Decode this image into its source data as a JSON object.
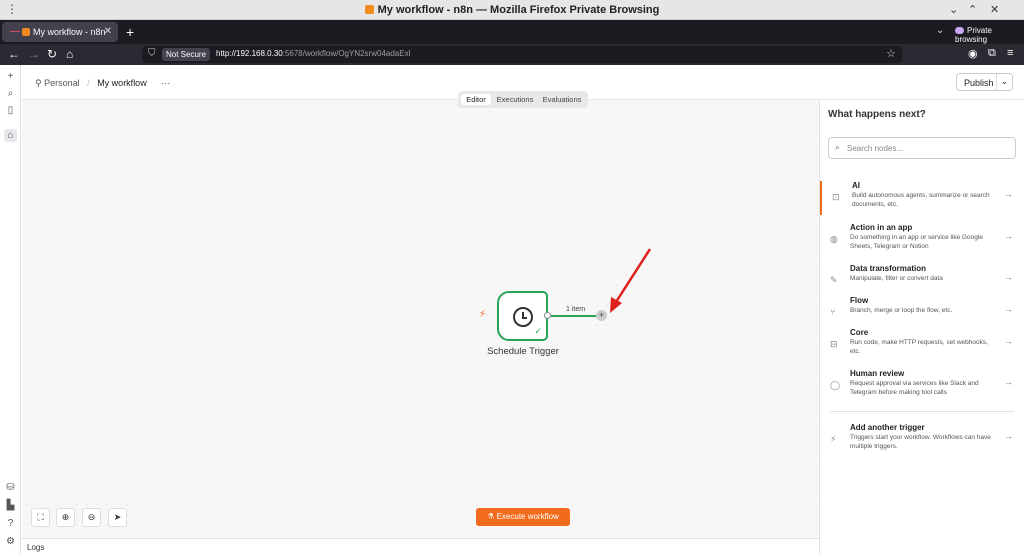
{
  "browser": {
    "window_title": "My workflow - n8n — Mozilla Firefox Private Browsing",
    "tab_title": "My workflow - n8n",
    "private_label": "Private browsing",
    "not_secure_label": "Not Secure",
    "url_host": "http://192.168.0.30",
    "url_rest": ":5678/workflow/OgYN2srw04adaExl"
  },
  "header": {
    "breadcrumb_personal": "Personal",
    "breadcrumb_separator": "/",
    "workflow_name": "My workflow",
    "more_label": "···",
    "publish_label": "Publish"
  },
  "view_tabs": [
    "Editor",
    "Executions",
    "Evaluations"
  ],
  "canvas": {
    "node_name": "Schedule Trigger",
    "connection_label": "1 item",
    "execute_label": "Execute workflow"
  },
  "footer": {
    "logs_label": "Logs"
  },
  "panel": {
    "title": "What happens next?",
    "search_placeholder": "Search nodes...",
    "options": [
      {
        "title": "AI",
        "desc": "Build autonomous agents, summarize or search documents, etc.",
        "icon": "robot-icon"
      },
      {
        "title": "Action in an app",
        "desc": "Do something in an app or service like Google Sheets, Telegram or Notion",
        "icon": "globe-icon"
      },
      {
        "title": "Data transformation",
        "desc": "Manipulate, filter or convert data",
        "icon": "pen-icon"
      },
      {
        "title": "Flow",
        "desc": "Branch, merge or loop the flow, etc.",
        "icon": "branch-icon"
      },
      {
        "title": "Core",
        "desc": "Run code, make HTTP requests, set webhooks, etc.",
        "icon": "toolbox-icon"
      },
      {
        "title": "Human review",
        "desc": "Request approval via services like Slack and Telegram before making tool calls",
        "icon": "check-circle-icon"
      }
    ],
    "trigger": {
      "title": "Add another trigger",
      "desc": "Triggers start your workflow. Workflows can have multiple triggers.",
      "icon": "bolt-icon"
    }
  },
  "colors": {
    "accent": "#f26b1d",
    "success": "#29a35a"
  }
}
